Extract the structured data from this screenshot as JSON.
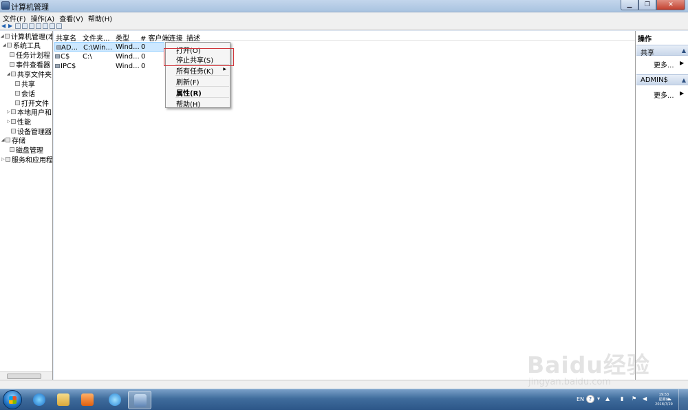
{
  "window": {
    "title": "计算机管理"
  },
  "menubar": {
    "file": "文件(F)",
    "action": "操作(A)",
    "view": "查看(V)",
    "help": "帮助(H)"
  },
  "tree": {
    "items": [
      {
        "label": "计算机管理(本地",
        "level": 0,
        "expanded": true
      },
      {
        "label": "系统工具",
        "level": 1,
        "expanded": true
      },
      {
        "label": "任务计划程",
        "level": 2
      },
      {
        "label": "事件查看器",
        "level": 2
      },
      {
        "label": "共享文件夹",
        "level": 2,
        "expanded": true
      },
      {
        "label": "共享",
        "level": 3
      },
      {
        "label": "会话",
        "level": 3
      },
      {
        "label": "打开文件",
        "level": 3
      },
      {
        "label": "本地用户和",
        "level": 2
      },
      {
        "label": "性能",
        "level": 2
      },
      {
        "label": "设备管理器",
        "level": 2
      },
      {
        "label": "存储",
        "level": 1,
        "expanded": true
      },
      {
        "label": "磁盘管理",
        "level": 2
      },
      {
        "label": "服务和应用程",
        "level": 1
      }
    ]
  },
  "list": {
    "columns": [
      "共享名",
      "文件夹...",
      "类型",
      "# 客户端连接",
      "描述"
    ],
    "rows": [
      {
        "name": "AD...",
        "path": "C:\\Win...",
        "type": "Wind...",
        "clients": "0",
        "selected": true
      },
      {
        "name": "C$",
        "path": "C:\\",
        "type": "Wind...",
        "clients": "0",
        "selected": false
      },
      {
        "name": "IPC$",
        "path": "",
        "type": "Wind...",
        "clients": "0",
        "selected": false
      }
    ]
  },
  "context_menu": {
    "items": [
      {
        "label": "打开(O)"
      },
      {
        "label": "停止共享(S)"
      },
      {
        "label": "所有任务(K)",
        "submenu": true
      },
      {
        "label": "刷新(F)"
      },
      {
        "label": "属性(R)",
        "bold": true
      },
      {
        "label": "帮助(H)"
      }
    ]
  },
  "actions": {
    "title": "操作",
    "sections": [
      {
        "label": "共享",
        "more": "更多..."
      },
      {
        "label": "ADMIN$",
        "more": "更多..."
      }
    ]
  },
  "taskbar": {
    "lang": "EN",
    "clock_time": "19:53",
    "clock_day": "星期日",
    "clock_date": "2018/7/29"
  },
  "watermark": {
    "main": "Baidu经验",
    "sub": "jingyan.baidu.com"
  }
}
